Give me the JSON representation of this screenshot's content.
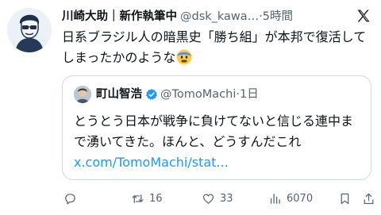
{
  "author": {
    "name": "川崎大助｜新作執筆中",
    "handle": "@dsk_kawa…",
    "dot": "·",
    "time": "5時間"
  },
  "tweet": {
    "text": "日系ブラジル人の暗黒史「勝ち組」が本邦で復活してしまったかのような"
  },
  "quote": {
    "name": "町山智浩",
    "handle": "@TomoMachi",
    "dot": "·",
    "time": "1日",
    "text": "とうとう日本が戦争に負けてないと信じる連中まで湧いてきた。ほんと、どうすんだこれ",
    "link": "x.com/TomoMachi/stat..."
  },
  "actions": {
    "reply_count": "",
    "retweet_count": "16",
    "like_count": "33",
    "views_count": "6070"
  },
  "icons": [
    "avatar",
    "x-logo",
    "fearful-emoji",
    "verified-badge",
    "reply-icon",
    "retweet-icon",
    "like-icon",
    "views-icon",
    "bookmark-icon",
    "share-icon"
  ],
  "colors": {
    "accent": "#1d9bf0",
    "muted": "#536471",
    "border": "#cfd9de",
    "emoji": "#ffcc4d"
  }
}
